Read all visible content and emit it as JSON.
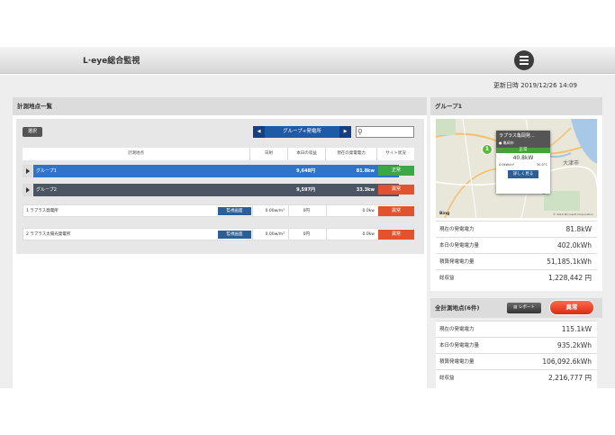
{
  "header": {
    "logo": "L·eye総合監視",
    "menu_icon": "hamburger-menu-icon"
  },
  "updated": "更新日時 2019/12/26 14:09",
  "list_panel": {
    "title": "計測地点一覧",
    "select_button": "選択",
    "group_selector": {
      "label": "グループ+発電所",
      "prev_icon": "◀",
      "next_icon": "▶"
    },
    "search": {
      "value": "",
      "placeholder": ""
    },
    "columns": [
      "計測地点",
      "日射",
      "本日の収益",
      "現在の発電電力",
      "サイト状況"
    ],
    "groups": [
      {
        "name": "グループ1",
        "revenue": "9,648円",
        "power": "81.8kw",
        "status": "正常",
        "color": "#2e74c8",
        "status_color": "#3aa847"
      },
      {
        "name": "グループ2",
        "revenue": "9,597円",
        "power": "33.3kw",
        "status": "異常",
        "color": "#4b5563",
        "status_color": "#e2522f"
      }
    ],
    "sites": [
      {
        "name": "1 ラプラス発電所",
        "monitor": "監視画面",
        "irr": "0.00w/m²",
        "revenue": "0円",
        "power": "0.0kw",
        "status": "異常"
      },
      {
        "name": "2 ラプラス太陽光発電所",
        "monitor": "監視画面",
        "irr": "0.00w/m²",
        "revenue": "0円",
        "power": "0.0kw",
        "status": "異常"
      }
    ]
  },
  "group_panel": {
    "title": "グループ1",
    "map": {
      "popup_title": "ラプラス亀岡発...",
      "popup_sub": "亀岡市",
      "popup_status": "正常",
      "popup_power": "40.8kW",
      "popup_irr": "0.0kW/m²",
      "popup_temp": "30.0°C",
      "popup_button": "詳しく見る",
      "pin_label": "1",
      "city_label": "大津市",
      "footer": "Bing",
      "copyright": "© 2019 Microsoft Corporation"
    },
    "stats": [
      {
        "label": "現在の発電電力",
        "value": "81.8kW"
      },
      {
        "label": "本日の発電電力量",
        "value": "402.0kWh"
      },
      {
        "label": "積算発電電力量",
        "value": "51,185.1kWh"
      },
      {
        "label": "総収益",
        "value": "1,228,442 円"
      }
    ]
  },
  "all_panel": {
    "title": "全計測地点(6件)",
    "report_button": "レポート",
    "alert_button": "異常",
    "stats": [
      {
        "label": "現在の発電電力",
        "value": "115.1kW"
      },
      {
        "label": "本日の発電電力量",
        "value": "935.2kWh"
      },
      {
        "label": "積算発電電力量",
        "value": "106,092.6kWh"
      },
      {
        "label": "総収益",
        "value": "2,216,777 円"
      }
    ]
  }
}
